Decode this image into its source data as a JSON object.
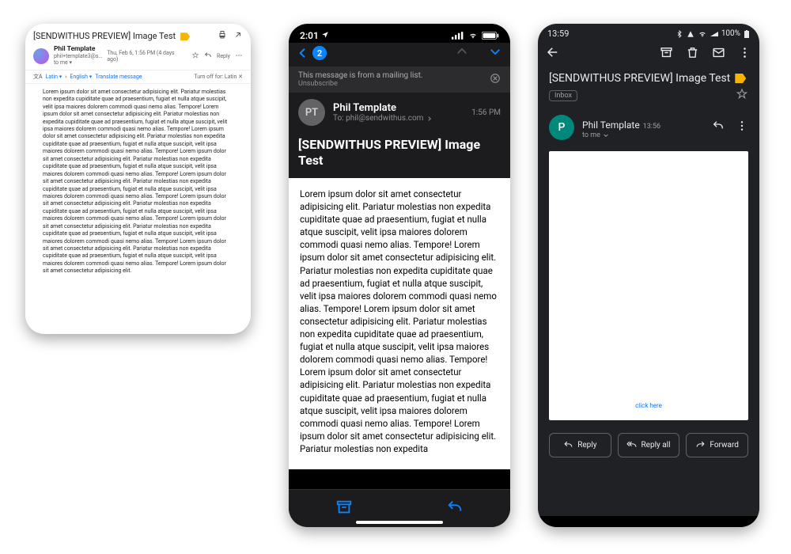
{
  "left": {
    "subject": "[SENDWITHUS PREVIEW] Image Test",
    "sender_name": "Phil Template",
    "sender_email": "phil+template3@s…",
    "date": "Thu, Feb 6, 1:56 PM (4 days ago)",
    "reply_label": "Reply",
    "to_line": "to me",
    "translate_icon": "文A",
    "lang_from": "Latin",
    "lang_to": "English",
    "translate_label": "Translate message",
    "translate_off": "Turn off for: Latin",
    "body": "Lorem ipsum dolor sit amet consectetur adipisicing elit. Pariatur molestias non expedita cupiditate quae ad praesentium, fugiat et nulla atque suscipit, velit ipsa maiores dolorem commodi quasi nemo alias. Tempore! Lorem ipsum dolor sit amet consectetur adipisicing elit. Pariatur molestias non expedita cupiditate quae ad praesentium, fugiat et nulla atque suscipit, velit ipsa maiores dolorem commodi quasi nemo alias. Tempore! Lorem ipsum dolor sit amet consectetur adipisicing elit. Pariatur molestias non expedita cupiditate quae ad praesentium, fugiat et nulla atque suscipit, velit ipsa maiores dolorem commodi quasi nemo alias. Tempore! Lorem ipsum dolor sit amet consectetur adipisicing elit. Pariatur molestias non expedita cupiditate quae ad praesentium, fugiat et nulla atque suscipit, velit ipsa maiores dolorem commodi quasi nemo alias. Tempore! Lorem ipsum dolor sit amet consectetur adipisicing elit. Pariatur molestias non expedita cupiditate quae ad praesentium, fugiat et nulla atque suscipit, velit ipsa maiores dolorem commodi quasi nemo alias. Tempore! Lorem ipsum dolor sit amet consectetur adipisicing elit. Pariatur molestias non expedita cupiditate quae ad praesentium, fugiat et nulla atque suscipit, velit ipsa maiores dolorem commodi quasi nemo alias. Tempore! Lorem ipsum dolor sit amet consectetur adipisicing elit. Pariatur molestias non expedita cupiditate quae ad praesentium, fugiat et nulla atque suscipit, velit ipsa maiores dolorem commodi quasi nemo alias. Tempore! Lorem ipsum dolor sit amet consectetur adipisicing elit. Pariatur molestias non expedita cupiditate quae ad praesentium, fugiat et nulla atque suscipit, velit ipsa maiores dolorem commodi quasi nemo alias. Tempore! Lorem ipsum dolor sit amet consectetur adipisicing elit."
  },
  "mid": {
    "time": "2:01",
    "badge": "2",
    "banner_title": "This message is from a mailing list.",
    "banner_sub": "Unsubscribe",
    "avatar_initials": "PT",
    "sender_name": "Phil Template",
    "to_line": "To: phil@sendwithus.com",
    "msg_time": "1:56 PM",
    "subject": "[SENDWITHUS PREVIEW] Image Test",
    "body": "Lorem ipsum dolor sit amet consectetur adipisicing elit. Pariatur molestias non expedita cupiditate quae ad praesentium, fugiat et nulla atque suscipit, velit ipsa maiores dolorem commodi quasi nemo alias. Tempore! Lorem ipsum dolor sit amet consectetur adipisicing elit. Pariatur molestias non expedita cupiditate quae ad praesentium, fugiat et nulla atque suscipit, velit ipsa maiores dolorem commodi quasi nemo alias. Tempore! Lorem ipsum dolor sit amet consectetur adipisicing elit. Pariatur molestias non expedita cupiditate quae ad praesentium, fugiat et nulla atque suscipit, velit ipsa maiores dolorem commodi quasi nemo alias. Tempore! Lorem ipsum dolor sit amet consectetur adipisicing elit. Pariatur molestias non expedita cupiditate quae ad praesentium, fugiat et nulla atque suscipit, velit ipsa maiores dolorem commodi quasi nemo alias. Tempore! Lorem ipsum dolor sit amet consectetur adipisicing elit. Pariatur molestias non expedita"
  },
  "right": {
    "time": "13:59",
    "battery_pct": "100%",
    "subject": "[SENDWITHUS PREVIEW] Image Test",
    "inbox_chip": "Inbox",
    "avatar_initial": "P",
    "sender_name": "Phil Template",
    "msg_time": "13:56",
    "to_line": "to me",
    "click_here": "click here",
    "actions": {
      "reply": "Reply",
      "reply_all": "Reply all",
      "forward": "Forward"
    }
  }
}
